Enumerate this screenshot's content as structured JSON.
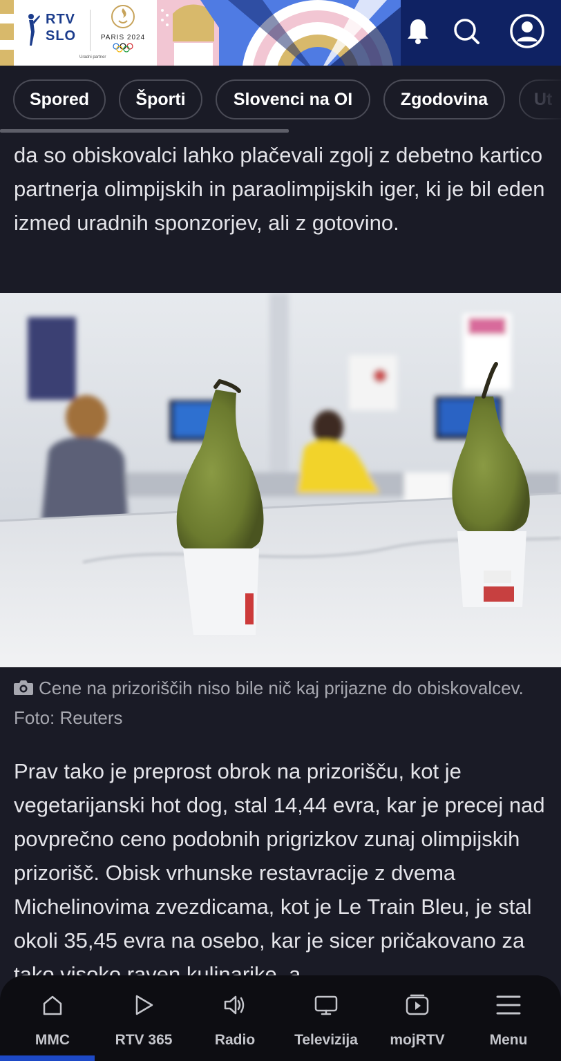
{
  "header": {
    "logo_line1": "RTV",
    "logo_line2": "SLO",
    "paris_label": "PARIS 2024",
    "partner_label": "Uradni partner",
    "icons": [
      "bell-icon",
      "search-icon",
      "profile-icon"
    ]
  },
  "categories": [
    {
      "label": "Spored"
    },
    {
      "label": "Športi"
    },
    {
      "label": "Slovenci na OI"
    },
    {
      "label": "Zgodovina"
    },
    {
      "label": "Ut"
    }
  ],
  "article": {
    "para_top": "da so obiskovalci lahko plačevali zgolj z debetno kartico partnerja olimpijskih in paraolimpijskih iger, ki je bil eden izmed uradnih sponzorjev, ali z gotovino.",
    "image_caption": "Cene na prizoriščih niso bile nič kaj prijazne do obiskovalcev. Foto: Reuters",
    "para_main": "Prav tako je preprost obrok na prizorišču, kot je vegetarijanski hot dog, stal 14,44 evra, kar je precej nad povprečno ceno podobnih prigrizkov zunaj olimpijskih prizorišč. Obisk vrhunske restavracije z dvema Michelinovima zvezdicama, kot je Le Train Bleu, je stal okoli 35,45 evra na osebo, kar je sicer pričakovano za tako visoko raven kulinarike, a"
  },
  "bottom_nav": [
    {
      "label": "MMC",
      "icon": "home-icon",
      "active": true
    },
    {
      "label": "RTV 365",
      "icon": "play-icon",
      "active": false
    },
    {
      "label": "Radio",
      "icon": "speaker-icon",
      "active": false
    },
    {
      "label": "Televizija",
      "icon": "tv-icon",
      "active": false
    },
    {
      "label": "mojRTV",
      "icon": "video-play-icon",
      "active": false
    },
    {
      "label": "Menu",
      "icon": "hamburger-icon",
      "active": false
    }
  ],
  "colors": {
    "background": "#1a1b26",
    "header": "#0f2263",
    "accent": "#1d49c6",
    "chip_border": "#4a4b56"
  }
}
